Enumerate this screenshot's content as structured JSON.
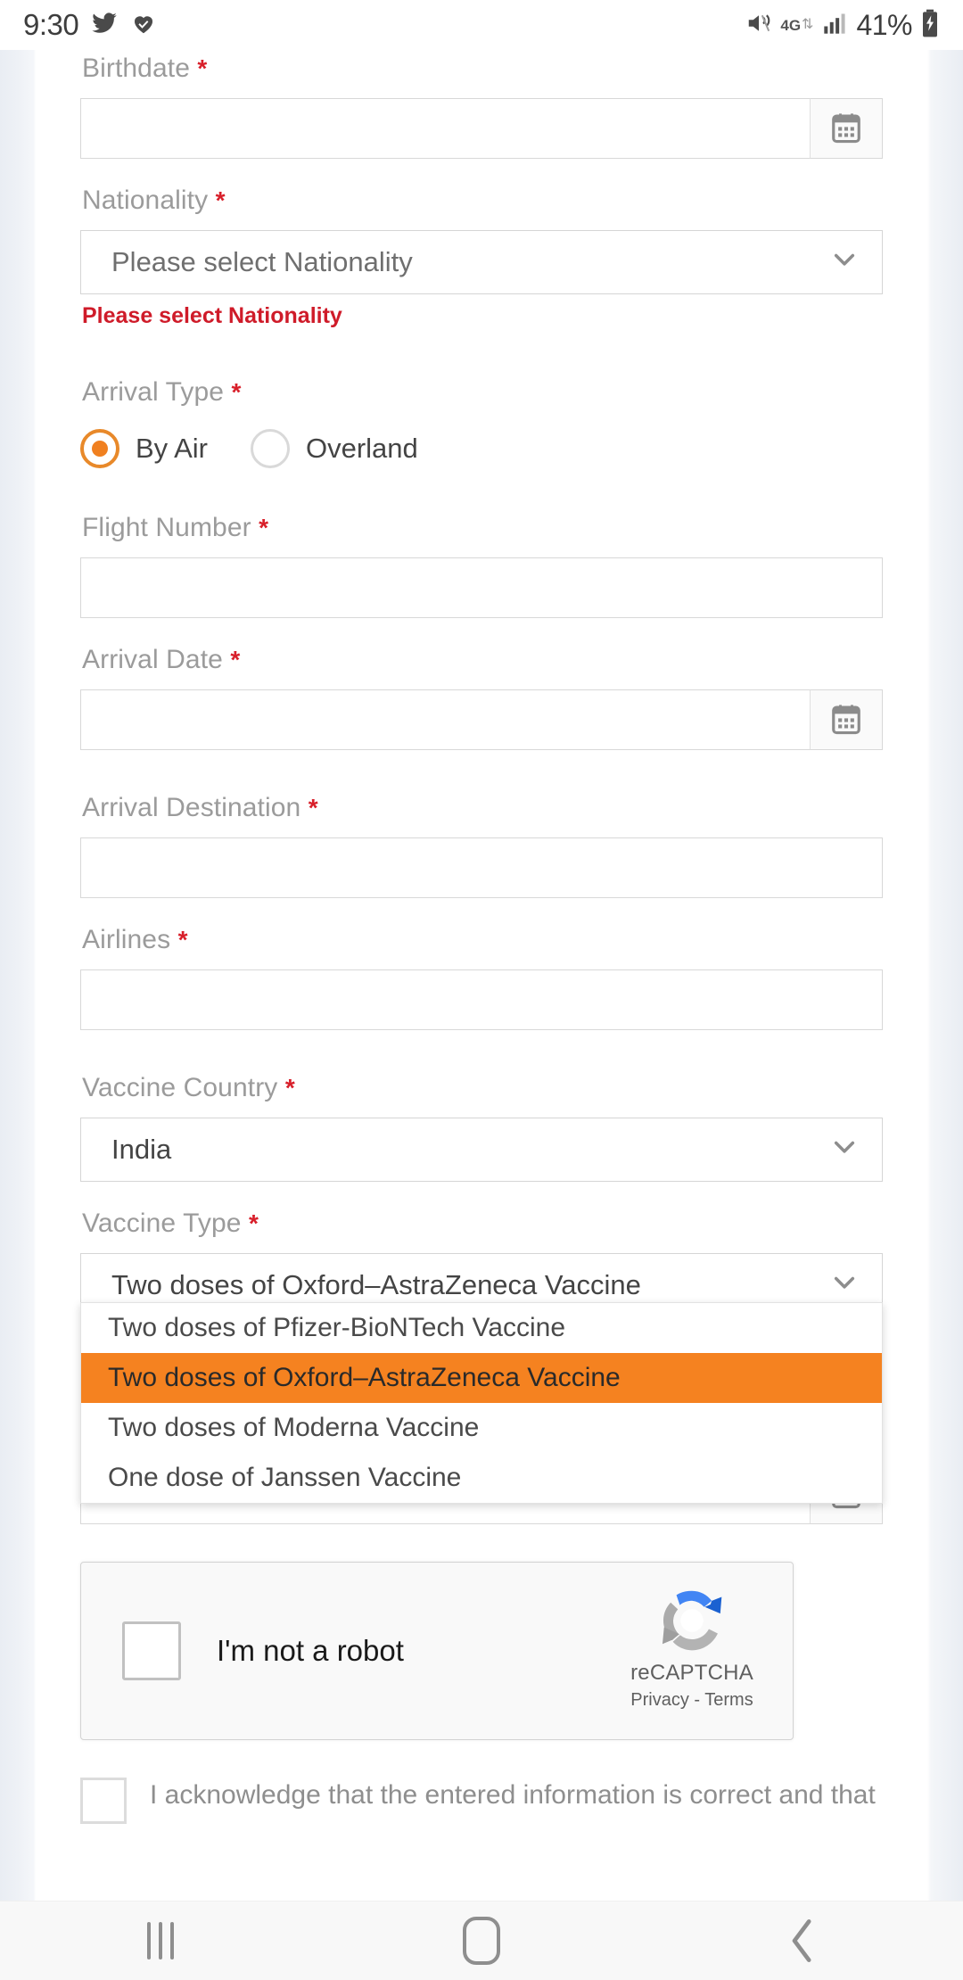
{
  "statusbar": {
    "time": "9:30",
    "icons_left": [
      "twitter-icon",
      "heart-check-icon"
    ],
    "network_type": "4G",
    "battery_percent": "41%",
    "icons_right": [
      "mute-icon",
      "data-transfer-icon",
      "signal-bars-icon",
      "battery-charging-icon"
    ]
  },
  "form": {
    "birthdate": {
      "label": "Birthdate",
      "required_mark": "*",
      "value": "",
      "calendar_icon": "calendar-icon"
    },
    "nationality": {
      "label": "Nationality",
      "required_mark": "*",
      "value": "Please select Nationality",
      "error": "Please select Nationality"
    },
    "arrival_type": {
      "label": "Arrival Type",
      "required_mark": "*",
      "options": [
        {
          "label": "By Air",
          "selected": true
        },
        {
          "label": "Overland",
          "selected": false
        }
      ]
    },
    "flight_number": {
      "label": "Flight Number",
      "required_mark": "*",
      "value": ""
    },
    "arrival_date": {
      "label": "Arrival Date",
      "required_mark": "*",
      "value": "",
      "calendar_icon": "calendar-icon"
    },
    "arrival_destination": {
      "label": "Arrival Destination",
      "required_mark": "*",
      "value": ""
    },
    "airlines": {
      "label": "Airlines",
      "required_mark": "*",
      "value": ""
    },
    "vaccine_country": {
      "label": "Vaccine Country",
      "required_mark": "*",
      "value": "India"
    },
    "vaccine_type": {
      "label": "Vaccine Type",
      "required_mark": "*",
      "value": "Two doses of Oxford–AstraZeneca Vaccine",
      "options": [
        "Two doses of Pfizer-BioNTech Vaccine",
        "Two doses of Oxford–AstraZeneca Vaccine",
        "Two doses of Moderna Vaccine",
        "One dose of Janssen Vaccine"
      ],
      "selected_index": 1
    },
    "date_after_dropdown": {
      "value": "",
      "calendar_icon": "calendar-icon"
    }
  },
  "recaptcha": {
    "checkbox_label": "I'm not a robot",
    "brand": "reCAPTCHA",
    "links": "Privacy - Terms",
    "checked": false
  },
  "acknowledge": {
    "text": "I acknowledge that the entered information is correct and that",
    "checked": false
  },
  "navbar": {
    "recents": "recents-icon",
    "home": "home-icon",
    "back": "back-icon"
  },
  "colors": {
    "accent_orange": "#f58220",
    "error_red": "#cf1b29",
    "required_red": "#d81f2a",
    "label_grey": "#9b9b9b",
    "page_bg": "#eef1f5"
  }
}
